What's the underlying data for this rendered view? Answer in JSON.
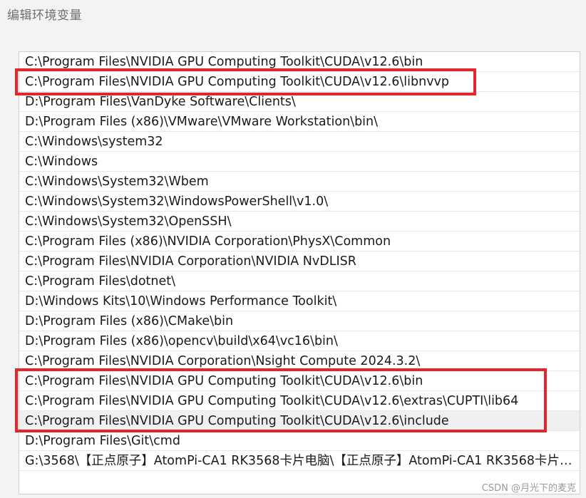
{
  "dialog": {
    "title": "编辑环境变量"
  },
  "path_list": {
    "items": [
      {
        "label": "C:\\Program Files\\NVIDIA GPU Computing Toolkit\\CUDA\\v12.6\\bin"
      },
      {
        "label": "C:\\Program Files\\NVIDIA GPU Computing Toolkit\\CUDA\\v12.6\\libnvvp"
      },
      {
        "label": "D:\\Program Files\\VanDyke Software\\Clients\\"
      },
      {
        "label": "D:\\Program Files (x86)\\VMware\\VMware Workstation\\bin\\"
      },
      {
        "label": "C:\\Windows\\system32"
      },
      {
        "label": "C:\\Windows"
      },
      {
        "label": "C:\\Windows\\System32\\Wbem"
      },
      {
        "label": "C:\\Windows\\System32\\WindowsPowerShell\\v1.0\\"
      },
      {
        "label": "C:\\Windows\\System32\\OpenSSH\\"
      },
      {
        "label": "C:\\Program Files (x86)\\NVIDIA Corporation\\PhysX\\Common"
      },
      {
        "label": "C:\\Program Files\\NVIDIA Corporation\\NVIDIA NvDLISR"
      },
      {
        "label": "C:\\Program Files\\dotnet\\"
      },
      {
        "label": "D:\\Windows Kits\\10\\Windows Performance Toolkit\\"
      },
      {
        "label": "D:\\Program Files (x86)\\CMake\\bin"
      },
      {
        "label": "D:\\Program Files (x86)\\opencv\\build\\x64\\vc16\\bin\\"
      },
      {
        "label": "C:\\Program Files\\NVIDIA Corporation\\Nsight Compute 2024.3.2\\"
      },
      {
        "label": "C:\\Program Files\\NVIDIA GPU Computing Toolkit\\CUDA\\v12.6\\bin"
      },
      {
        "label": "C:\\Program Files\\NVIDIA GPU Computing Toolkit\\CUDA\\v12.6\\extras\\CUPTI\\lib64"
      },
      {
        "label": "C:\\Program Files\\NVIDIA GPU Computing Toolkit\\CUDA\\v12.6\\include"
      },
      {
        "label": "D:\\Program Files\\Git\\cmd"
      },
      {
        "label": "G:\\3568\\【正点原子】AtomPi-CA1 RK3568卡片电脑\\【正点原子】AtomPi-CA1 RK3568卡片电脑..."
      }
    ],
    "selected_index": 18
  },
  "annotations": {
    "color": "#e3262c"
  },
  "watermark": {
    "text": "CSDN @月光下的麦克"
  }
}
